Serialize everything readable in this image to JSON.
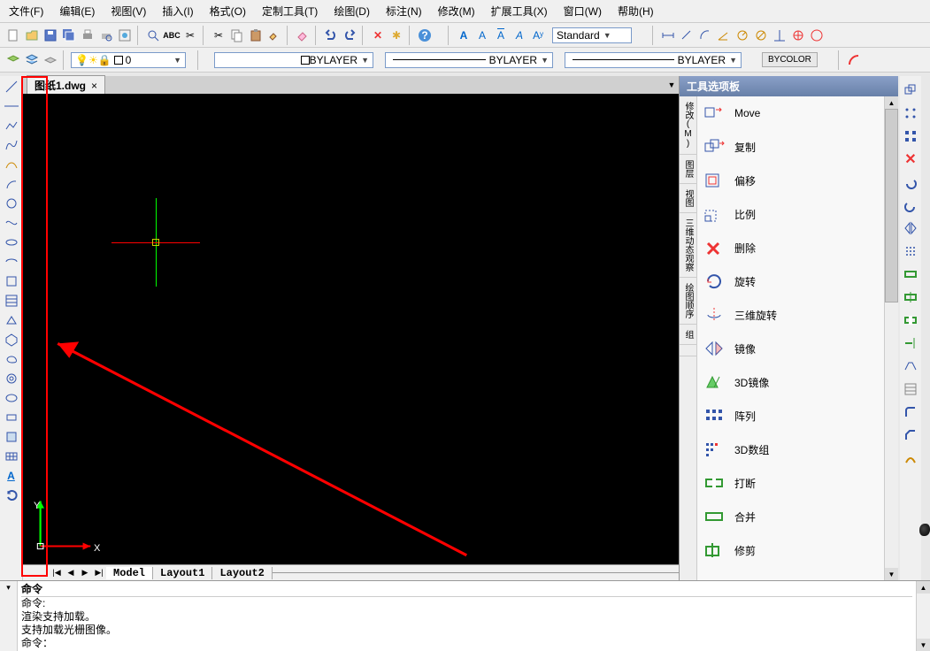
{
  "menu": {
    "items": [
      "文件(F)",
      "编辑(E)",
      "视图(V)",
      "插入(I)",
      "格式(O)",
      "定制工具(T)",
      "绘图(D)",
      "标注(N)",
      "修改(M)",
      "扩展工具(X)",
      "窗口(W)",
      "帮助(H)"
    ]
  },
  "toolbar1": {
    "style_value": "Standard"
  },
  "toolbar2": {
    "layer_value": "0",
    "bylayer1": "BYLAYER",
    "bylayer2": "BYLAYER",
    "bylayer3": "BYLAYER",
    "bycolor": "BYCOLOR"
  },
  "tabs": {
    "file": "图纸1.dwg",
    "close": "×"
  },
  "ucs": {
    "y": "Y",
    "x": "X"
  },
  "layout_tabs": {
    "model": "Model",
    "l1": "Layout1",
    "l2": "Layout2"
  },
  "palette": {
    "title": "工具选项板",
    "vtabs": [
      "修改(M)",
      "图层",
      "视图",
      "三维动态观察",
      "绘图顺序",
      "组",
      ""
    ],
    "items": [
      {
        "label": "Move",
        "icon": "move"
      },
      {
        "label": "复制",
        "icon": "copy"
      },
      {
        "label": "偏移",
        "icon": "offset"
      },
      {
        "label": "比例",
        "icon": "scale"
      },
      {
        "label": "删除",
        "icon": "delete"
      },
      {
        "label": "旋转",
        "icon": "rotate"
      },
      {
        "label": "三维旋转",
        "icon": "rotate3d"
      },
      {
        "label": "镜像",
        "icon": "mirror"
      },
      {
        "label": "3D镜像",
        "icon": "mirror3d"
      },
      {
        "label": "阵列",
        "icon": "array"
      },
      {
        "label": "3D数组",
        "icon": "array3d"
      },
      {
        "label": "打断",
        "icon": "break"
      },
      {
        "label": "合并",
        "icon": "join"
      },
      {
        "label": "修剪",
        "icon": "trim"
      }
    ]
  },
  "cmd": {
    "header": "命令",
    "line1": "命令:",
    "line2": "渲染支持加载。",
    "line3": "支持加载光栅图像。",
    "line4": "命令："
  }
}
